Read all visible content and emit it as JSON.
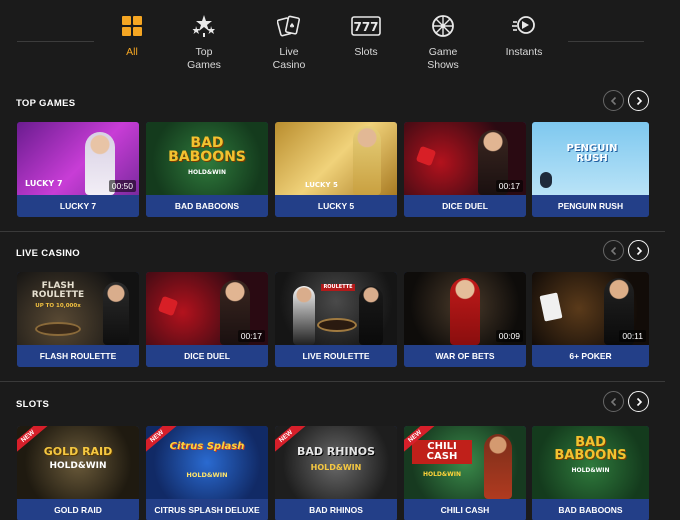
{
  "categories": [
    {
      "label": "All",
      "icon": "grid-icon",
      "active": true
    },
    {
      "label": "Top\nGames",
      "icon": "stars-icon",
      "active": false
    },
    {
      "label": "Live\nCasino",
      "icon": "playing-cards-icon",
      "active": false
    },
    {
      "label": "Slots",
      "icon": "seven-seven-seven-icon",
      "active": false
    },
    {
      "label": "Game\nShows",
      "icon": "wheel-icon",
      "active": false
    },
    {
      "label": "Instants",
      "icon": "rocket-icon",
      "active": false
    }
  ],
  "sections": [
    {
      "title": "TOP GAMES",
      "games": [
        {
          "name": "LUCKY 7",
          "art_label": "LUCKY 7",
          "timer": "00:50"
        },
        {
          "name": "BAD BABOONS",
          "art_label": "BAD\nBABOONS",
          "art_sub": "HOLD&WIN"
        },
        {
          "name": "LUCKY 5",
          "art_label": "LUCKY 5"
        },
        {
          "name": "DICE DUEL",
          "timer": "00:17"
        },
        {
          "name": "PENGUIN RUSH",
          "art_label": "PENGUIN\nRUSH"
        }
      ]
    },
    {
      "title": "LIVE CASINO",
      "games": [
        {
          "name": "FLASH ROULETTE",
          "art_label": "FLASH\nROULETTE",
          "art_sub": "UP TO 10,000x"
        },
        {
          "name": "DICE DUEL",
          "timer": "00:17"
        },
        {
          "name": "LIVE ROULETTE",
          "art_label": "ROULETTE"
        },
        {
          "name": "WAR OF BETS",
          "timer": "00:09"
        },
        {
          "name": "6+ POKER",
          "timer": "00:11"
        }
      ]
    },
    {
      "title": "SLOTS",
      "games": [
        {
          "name": "GOLD RAID",
          "art_label": "GOLD RAID",
          "art_sub": "HOLD&WIN",
          "ribbon": "NEW"
        },
        {
          "name": "CITRUS SPLASH DELUXE",
          "art_label": "Citrus Splash",
          "art_sub": "HOLD&WIN",
          "ribbon": "NEW"
        },
        {
          "name": "BAD RHINOS",
          "art_label": "BAD RHINOS",
          "art_sub": "HOLD&WIN",
          "ribbon": "NEW"
        },
        {
          "name": "CHILI CASH",
          "art_label": "CHILI\nCASH",
          "art_sub": "HOLD&WIN",
          "ribbon": "NEW"
        },
        {
          "name": "BAD BABOONS",
          "art_label": "BAD\nBABOONS",
          "art_sub": "HOLD&WIN"
        }
      ]
    }
  ],
  "colors": {
    "accent": "#f5a623",
    "caption": "#233f88",
    "background": "#1b1b1b"
  }
}
